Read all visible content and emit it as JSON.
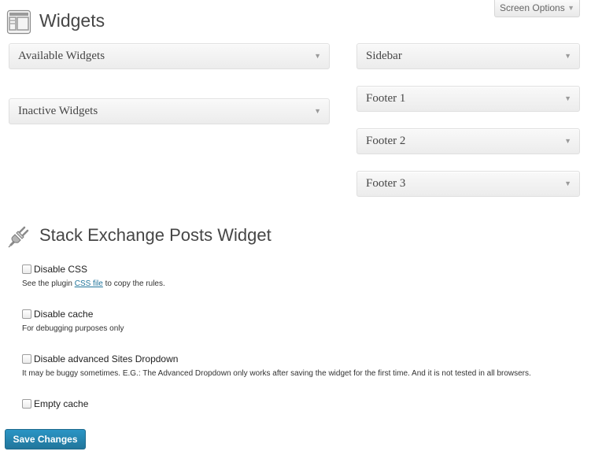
{
  "header": {
    "title": "Widgets",
    "screen_options_label": "Screen Options",
    "screen_options_icon": "triangle-down-icon"
  },
  "left_column": {
    "boxes": [
      {
        "label": "Available Widgets"
      },
      {
        "label": "Inactive Widgets"
      }
    ]
  },
  "right_column": {
    "boxes": [
      {
        "label": "Sidebar"
      },
      {
        "label": "Footer 1"
      },
      {
        "label": "Footer 2"
      },
      {
        "label": "Footer 3"
      }
    ]
  },
  "plugin_settings": {
    "title": "Stack Exchange Posts Widget",
    "icon": "plug-icon",
    "options": [
      {
        "label": "Disable CSS",
        "checked": false,
        "desc_before": "See the plugin ",
        "desc_link": "CSS file",
        "desc_after": " to copy the rules."
      },
      {
        "label": "Disable cache",
        "checked": false,
        "desc": "For debugging purposes only"
      },
      {
        "label": "Disable advanced Sites Dropdown",
        "checked": false,
        "desc": "It may be buggy sometimes. E.G.: The Advanced Dropdown only works after saving the widget for the first time. And it is not tested in all browsers."
      },
      {
        "label": "Empty cache",
        "checked": false
      }
    ]
  },
  "footer": {
    "save_label": "Save Changes"
  },
  "colors": {
    "primary_button": "#21759b",
    "link": "#21759b"
  }
}
